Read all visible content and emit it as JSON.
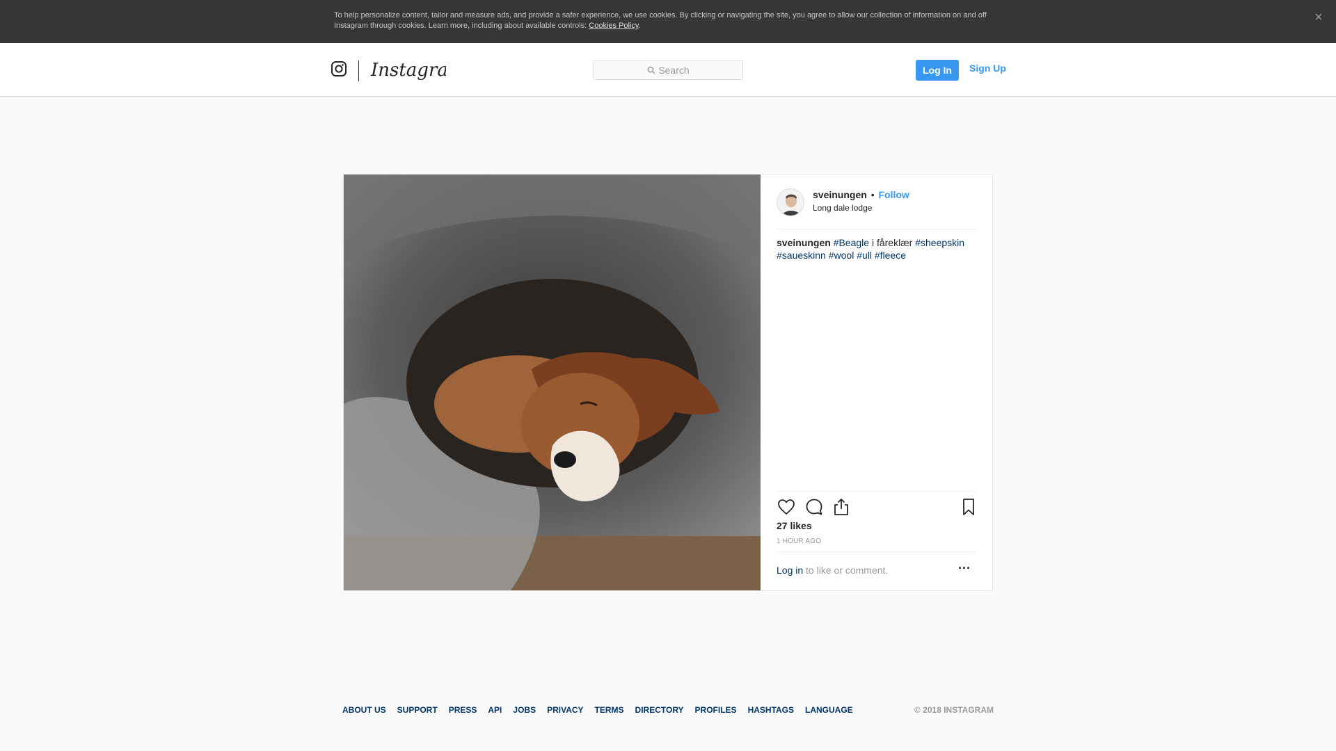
{
  "cookie_banner": {
    "text": "To help personalize content, tailor and measure ads, and provide a safer experience, we use cookies. By clicking or navigating the site, you agree to allow our collection of information on and off Instagram through cookies. Learn more, including about available controls: ",
    "link": "Cookies Policy",
    "trailing": ".",
    "close_icon": "close-icon"
  },
  "header": {
    "brand": "Instagram",
    "search": {
      "placeholder": "Search",
      "icon": "search-icon"
    },
    "login_label": "Log In",
    "signup_label": "Sign Up",
    "accent": "#3897f0"
  },
  "post": {
    "username": "sveinungen",
    "separator": "•",
    "follow_label": "Follow",
    "location": "Long dale lodge",
    "caption": {
      "user": "sveinungen",
      "tag1": "#Beagle",
      "text1": "i fårеklær",
      "tag2": "#sheepskin",
      "tag3": "#saueskinn",
      "tag4": "#wool",
      "tag5": "#ull",
      "tag6": "#fleece"
    },
    "actions": {
      "like": "heart-icon",
      "comment": "comment-icon",
      "share": "share-icon",
      "save": "bookmark-icon"
    },
    "likes": "27 likes",
    "time": "1 HOUR AGO",
    "login_link": "Log in",
    "login_rest": "to like or comment.",
    "more_icon": "more-options-icon"
  },
  "footer": {
    "links": [
      "ABOUT US",
      "SUPPORT",
      "PRESS",
      "API",
      "JOBS",
      "PRIVACY",
      "TERMS",
      "DIRECTORY",
      "PROFILES",
      "HASHTAGS",
      "LANGUAGE"
    ],
    "copyright": "© 2018 INSTAGRAM"
  }
}
